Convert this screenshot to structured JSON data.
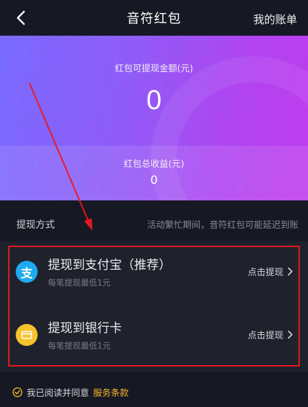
{
  "header": {
    "title": "音符红包",
    "bill_link": "我的账单"
  },
  "hero": {
    "withdrawable_label": "红包可提现金额(元)",
    "withdrawable_amount": "0",
    "total_label": "红包总收益(元)",
    "total_amount": "0"
  },
  "section": {
    "title": "提现方式",
    "note": "活动繁忙期间，音符红包可能延迟到账"
  },
  "methods": [
    {
      "name": "提现到支付宝（推荐）",
      "sub": "每笔提现最低1元",
      "action": "点击提现",
      "icon": "alipay-icon",
      "icon_glyph": "支",
      "icon_color": "#1eaaf1"
    },
    {
      "name": "提现到银行卡",
      "sub": "每笔提现最低1元",
      "action": "点击提现",
      "icon": "bank-card-icon",
      "icon_color": "#f7c22e"
    }
  ],
  "footer": {
    "agree_text": "我已阅读并同意",
    "agree_link": "服务条款"
  },
  "colors": {
    "background": "#161823",
    "hero_gradient_start": "#7a6bff",
    "hero_gradient_end": "#c03cee",
    "annotation_red": "#e8191f",
    "link_gold": "#f6b92b"
  }
}
